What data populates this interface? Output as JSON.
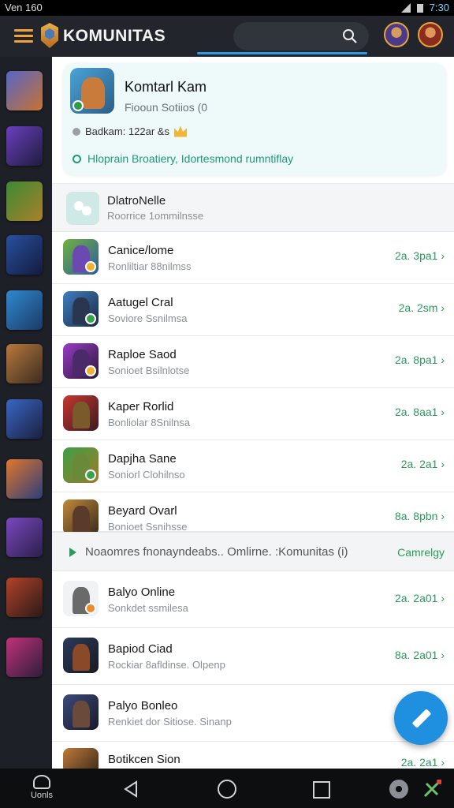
{
  "status_bar": {
    "carrier": "Ven 160",
    "time": "7:30"
  },
  "app_bar": {
    "app_name": "KOMUNITAS",
    "search_value": ""
  },
  "colors": {
    "accent": "#2c9be8",
    "green": "#2a9a5c",
    "brand_orange": "#f0a33a"
  },
  "group_card": {
    "title": "Komtarl Kam",
    "subtitle": "Fiooun Sotiios (0",
    "meta": "Badkam: 122ar &s",
    "link": "Hloprain Broatiery, Idortesmond rumntiflay"
  },
  "section_header": {
    "title": "DlatroNelle",
    "subtitle": "Roorrice 1ommilnsse"
  },
  "chats_top": [
    {
      "name": "Canice/lome",
      "subtitle": "Ronliltiar 88nilmss",
      "time": "2a. 3pa1 ›"
    },
    {
      "name": "Aatugel Cral",
      "subtitle": "Soviore Ssnilmsa",
      "time": "2a. 2sm ›"
    },
    {
      "name": "Raploe Saod",
      "subtitle": "Sonioet Bsilnlotse",
      "time": "2a. 8pa1 ›"
    },
    {
      "name": "Kaper Rorlid",
      "subtitle": "Bonliolar 8Snilnsa",
      "time": "2a. 8aa1 ›"
    },
    {
      "name": "Dapjha Sane",
      "subtitle": "Soniorl Clohilnso",
      "time": "2a. 2a1 ›"
    },
    {
      "name": "Beyard Ovarl",
      "subtitle": "Bonioet Ssnihsse",
      "time": "8a. 8pbn ›"
    }
  ],
  "banner": {
    "text": "Noaomres fnonayndeabs.. Omlirne. :Komunitas (i)",
    "link": "Camrelgy"
  },
  "chats_bottom": [
    {
      "name": "Balyo Online",
      "subtitle": "Sonkdet ssmilesa",
      "time": "2a. 2a01 ›"
    },
    {
      "name": "Bapiod Ciad",
      "subtitle": "Rockiar 8afldinse. Olpenp",
      "time": "8a. 2a01 ›"
    },
    {
      "name": "Palyo Bonleo",
      "subtitle": "Renkiet dor Sitiose. Sinanp",
      "time": "2"
    },
    {
      "name": "Botikcen Sion",
      "subtitle": "",
      "time": "2a. 2a1 ›"
    }
  ],
  "nav_bar": {
    "home_label": "Uonls"
  }
}
